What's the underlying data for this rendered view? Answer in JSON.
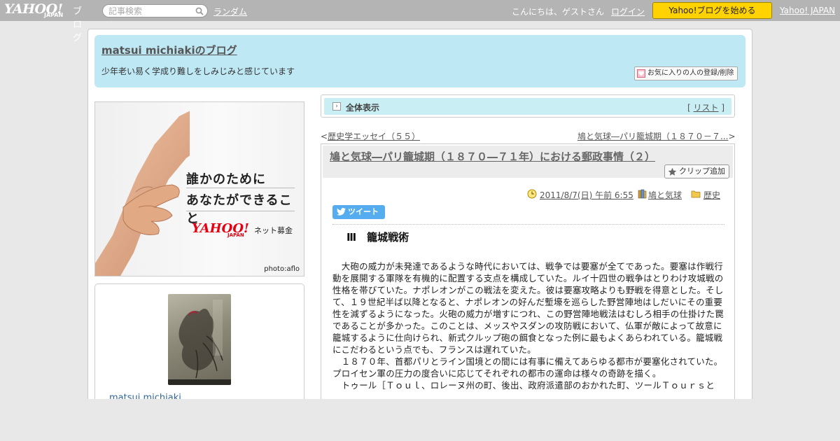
{
  "topbar": {
    "logo_yahoo": "YAHOO!",
    "logo_japan": "JAPAN",
    "logo_blog": "ブログ",
    "search_placeholder": "記事検索",
    "random_link": "ランダム",
    "greeting": "こんにちは、ゲストさん",
    "login_link": "ログイン",
    "start_button": "Yahoo!ブログを始める",
    "yahoo_japan_link": "Yahoo! JAPAN"
  },
  "header": {
    "blog_title": "matsui michiakiのブログ",
    "blog_description": "少年老い易く学成り難しをしみじみと感じています",
    "favorite_button": "お気に入りの人の登録/削除"
  },
  "ad": {
    "line1": "誰かのために",
    "line2": "あなたができること",
    "logo_yahoo": "YAHOO!",
    "logo_japan": "JAPAN",
    "service": "ネット募金",
    "credit": "photo:aflo"
  },
  "profile": {
    "name": "matsui michiaki"
  },
  "viewbar": {
    "label": "全体表示",
    "list_open": "[ ",
    "list_link": "リスト",
    "list_close": " ]"
  },
  "nav": {
    "prev": "歴史学エッセイ（５５）",
    "next": "鳩と気球―パリ籠城期（１８７０－７..."
  },
  "article": {
    "title": "鳩と気球―パリ籠城期（１８７０―７１年）における郵政事情（２）",
    "clip_button": "クリップ追加",
    "date": "2011/8/7(日) 午前 6:55",
    "category1": "鳩と気球",
    "category2": "歴史",
    "tweet_button": "ツイート",
    "section_heading": "Ⅲ　籠城戦術",
    "paragraphs": [
      "　大砲の威力が未発達であるような時代においては、戦争では要塞が全てであった。要塞は作戦行動を展開する軍隊を有機的に配置する支点を構成していた。ルイ十四世の戦争はとりわけ攻城戦の性格を帯びていた。ナポレオンがこの戦法を変えた。彼は要塞攻略よりも野戦を得意とした。そして、１９世紀半ば以降となると、ナポレオンの好んだ塹壕を巡らした野営陣地はしだいにその重要性を減ずるようになった。火砲の威力が増すにつれ、この野営陣地戦法はむしろ相手の仕掛けた罠であることが多かった。このことは、メッスやスダンの攻防戦において、仏軍が敵によって故意に籠城するように仕向けられ、新式クルップ砲の餌食となった例に最もよくあらわれている。籠城戦にこだわるという点でも、フランスは遅れていた。",
      "　１８７０年、首都パリとライン国境との間には有事に備えてあらゆる都市が要塞化されていた。プロイセン軍の圧力の度合いに応じてそれぞれの都市の運命は様々の奇跡を描く。",
      "　トゥール［Ｔｏｕｌ、ロレーヌ州の町、後出、政府派遣部のおかれた町、ツールＴｏｕｒｓと"
    ]
  }
}
